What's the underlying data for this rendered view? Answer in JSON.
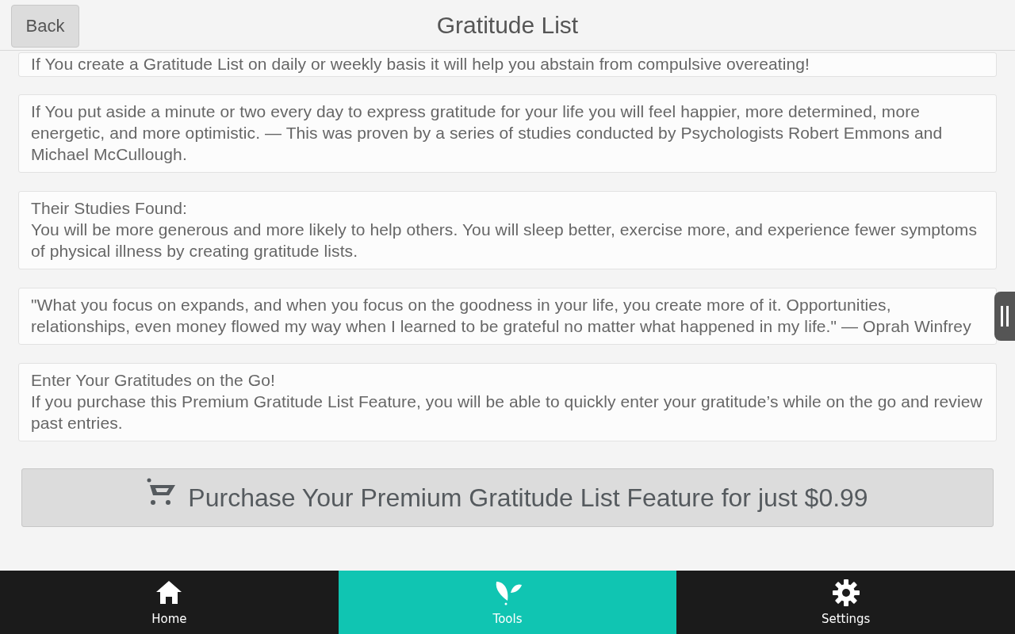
{
  "header": {
    "back_button": "Back",
    "title": "Gratitude List"
  },
  "cards": [
    {
      "lines": [
        "If You create a Gratitude List on daily or weekly basis it will help you abstain from compulsive overeating!"
      ]
    },
    {
      "lines": [
        "If You put aside a minute or two every day to express gratitude for your life you will feel happier, more determined, more energetic, and more optimistic. — This was proven by a series of studies conducted by Psychologists Robert Emmons and Michael McCullough."
      ]
    },
    {
      "lines": [
        "Their Studies Found:",
        "You will be more generous and more likely to help others. You will sleep better, exercise more, and experience fewer symptoms of physical illness by creating gratitude lists."
      ]
    },
    {
      "lines": [
        "\"What you focus on expands, and when you focus on the goodness in your life, you create more of it. Opportunities, relationships, even money flowed my way when I learned to be grateful no matter what happened in my life.\" — Oprah Winfrey"
      ]
    },
    {
      "lines": [
        "Enter Your Gratitudes on the Go!",
        "If you purchase this Premium Gratitude List Feature, you will be able to quickly enter your gratitude’s while on the go and review past entries."
      ]
    }
  ],
  "purchase_button": "Purchase Your Premium Gratitude List Feature for just $0.99",
  "nav": [
    {
      "label": "Home",
      "kind": "home",
      "selected": false
    },
    {
      "label": "Tools",
      "kind": "leaf",
      "selected": true
    },
    {
      "label": "Settings",
      "kind": "gear",
      "selected": false
    }
  ]
}
